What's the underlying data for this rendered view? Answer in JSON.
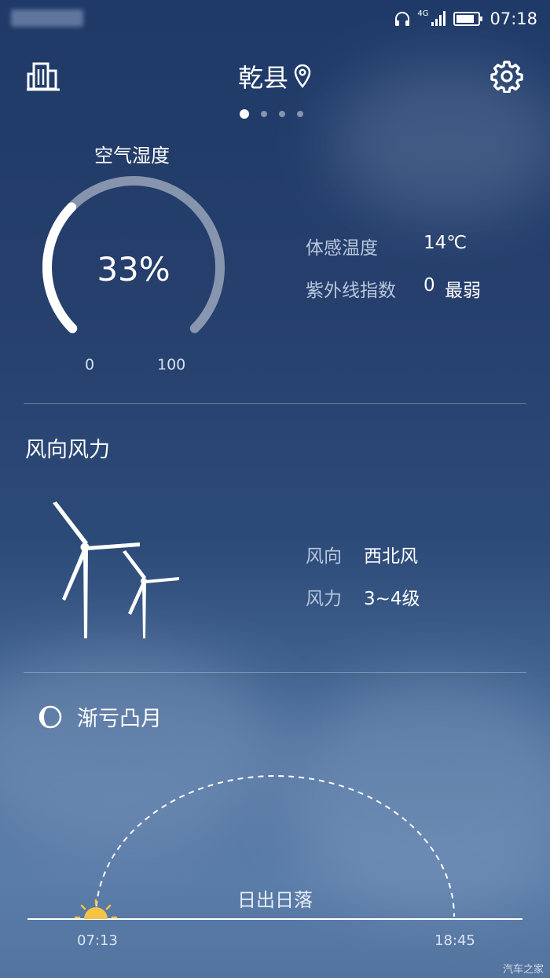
{
  "status_bar": {
    "network": "4G",
    "time": "07:18"
  },
  "header": {
    "city": "乾县",
    "pager_total": 4,
    "pager_active": 0
  },
  "humidity": {
    "title": "空气湿度",
    "value": "33%",
    "percent": 33,
    "min_label": "0",
    "max_label": "100"
  },
  "comfort": {
    "feels_like_label": "体感温度",
    "feels_like_value": "14℃",
    "uv_label": "紫外线指数",
    "uv_value": "0",
    "uv_level": "最弱"
  },
  "wind": {
    "title": "风向风力",
    "direction_label": "风向",
    "direction_value": "西北风",
    "force_label": "风力",
    "force_value": "3~4级"
  },
  "moon": {
    "phase": "渐亏凸月"
  },
  "sun": {
    "title": "日出日落",
    "sunrise": "07:13",
    "sunset": "18:45",
    "progress": 0.0
  },
  "watermark": "汽车之家",
  "colors": {
    "accent_sun": "#f6c445",
    "text": "#ffffff",
    "muted_text": "#b9c7dc"
  }
}
